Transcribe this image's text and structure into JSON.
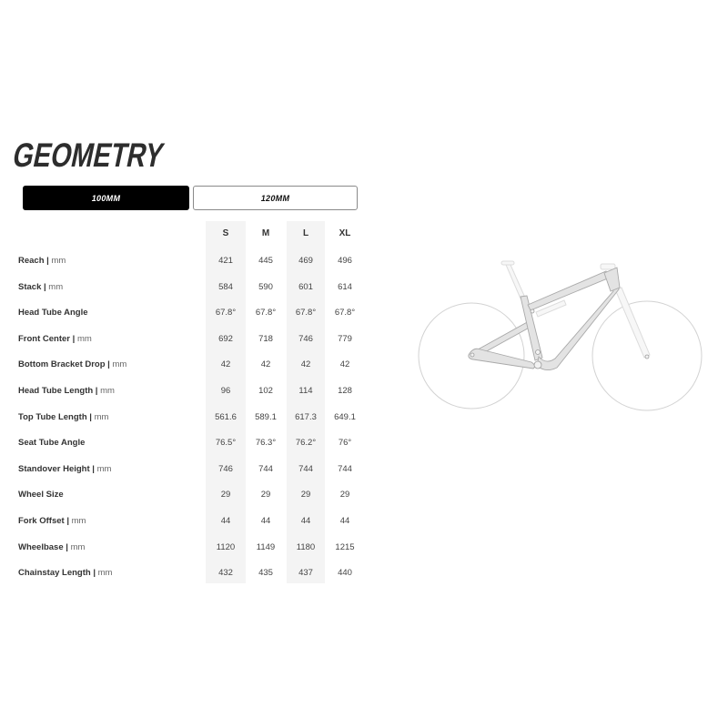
{
  "title": "GEOMETRY",
  "tabs": [
    {
      "label": "100MM",
      "active": true
    },
    {
      "label": "120MM",
      "active": false
    }
  ],
  "table": {
    "sizes": [
      "S",
      "M",
      "L",
      "XL"
    ],
    "rows": [
      {
        "label": "Reach",
        "unit": "mm",
        "values": [
          "421",
          "445",
          "469",
          "496"
        ]
      },
      {
        "label": "Stack",
        "unit": "mm",
        "values": [
          "584",
          "590",
          "601",
          "614"
        ]
      },
      {
        "label": "Head Tube Angle",
        "unit": "",
        "values": [
          "67.8°",
          "67.8°",
          "67.8°",
          "67.8°"
        ]
      },
      {
        "label": "Front Center",
        "unit": "mm",
        "values": [
          "692",
          "718",
          "746",
          "779"
        ]
      },
      {
        "label": "Bottom Bracket Drop",
        "unit": "mm",
        "values": [
          "42",
          "42",
          "42",
          "42"
        ]
      },
      {
        "label": "Head Tube Length",
        "unit": "mm",
        "values": [
          "96",
          "102",
          "114",
          "128"
        ]
      },
      {
        "label": "Top Tube Length",
        "unit": "mm",
        "values": [
          "561.6",
          "589.1",
          "617.3",
          "649.1"
        ]
      },
      {
        "label": "Seat Tube Angle",
        "unit": "",
        "values": [
          "76.5°",
          "76.3°",
          "76.2°",
          "76°"
        ]
      },
      {
        "label": "Standover Height",
        "unit": "mm",
        "values": [
          "746",
          "744",
          "744",
          "744"
        ]
      },
      {
        "label": "Wheel Size",
        "unit": "",
        "values": [
          "29",
          "29",
          "29",
          "29"
        ]
      },
      {
        "label": "Fork Offset",
        "unit": "mm",
        "values": [
          "44",
          "44",
          "44",
          "44"
        ]
      },
      {
        "label": "Wheelbase",
        "unit": "mm",
        "values": [
          "1120",
          "1149",
          "1180",
          "1215"
        ]
      },
      {
        "label": "Chainstay Length",
        "unit": "mm",
        "values": [
          "432",
          "435",
          "437",
          "440"
        ]
      }
    ]
  },
  "illustration": {
    "subject": "full-suspension-bike-diagram-icon"
  },
  "colors": {
    "tab_active_bg": "#000000",
    "column_shade": "#f4f4f4",
    "text": "#333333"
  }
}
